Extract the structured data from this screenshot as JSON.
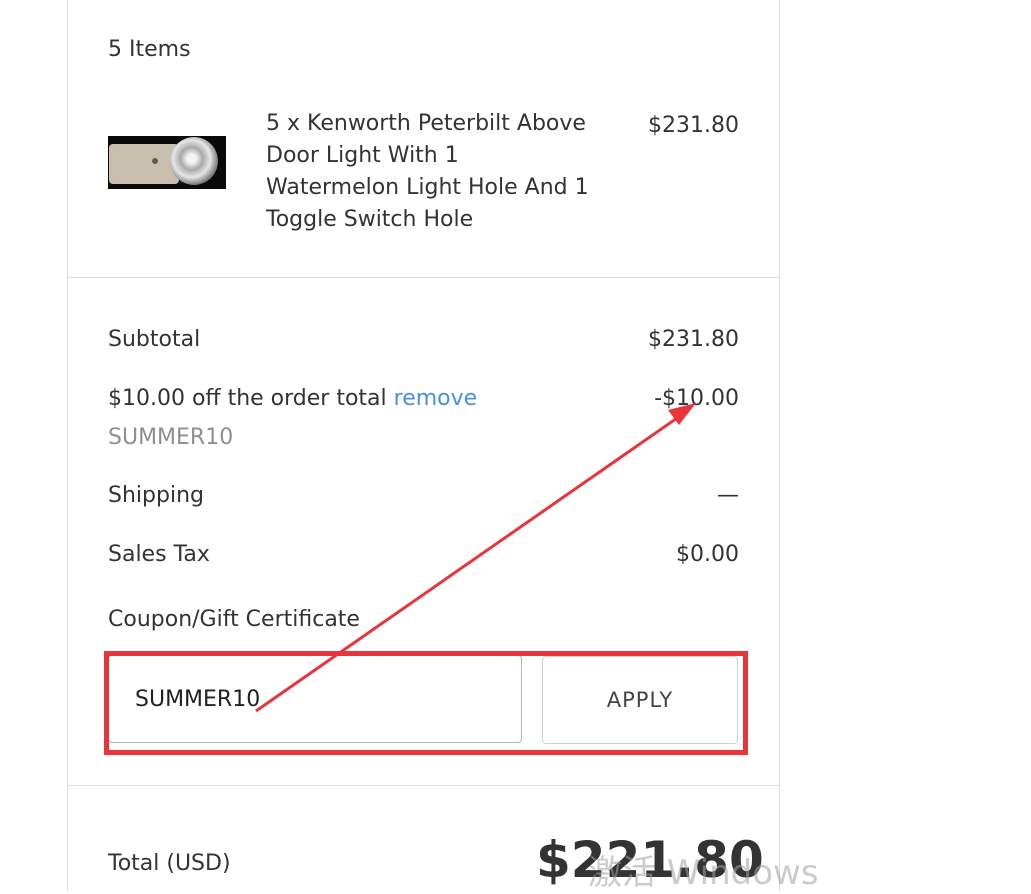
{
  "cart": {
    "items_count": "5 Items",
    "item": {
      "title": "5 x Kenworth Peterbilt Above Door Light With 1 Watermelon Light Hole And 1 Toggle Switch Hole",
      "price": "$231.80",
      "image_alt": "Above Door Light"
    }
  },
  "summary": {
    "subtotal_label": "Subtotal",
    "subtotal_value": "$231.80",
    "discount_label": "$10.00 off the order total",
    "discount_remove": "remove",
    "discount_value": "-$10.00",
    "discount_code": "SUMMER10",
    "shipping_label": "Shipping",
    "shipping_value": "—",
    "tax_label": "Sales Tax",
    "tax_value": "$0.00"
  },
  "coupon": {
    "label": "Coupon/Gift Certificate",
    "value": "SUMMER10",
    "apply_label": "APPLY"
  },
  "total": {
    "label": "Total (USD)",
    "value": "$221.80"
  },
  "watermark": "激活 Windows",
  "colors": {
    "annotation": "#e8353b",
    "link": "#4a90e2",
    "divider": "#dcdcdc"
  }
}
